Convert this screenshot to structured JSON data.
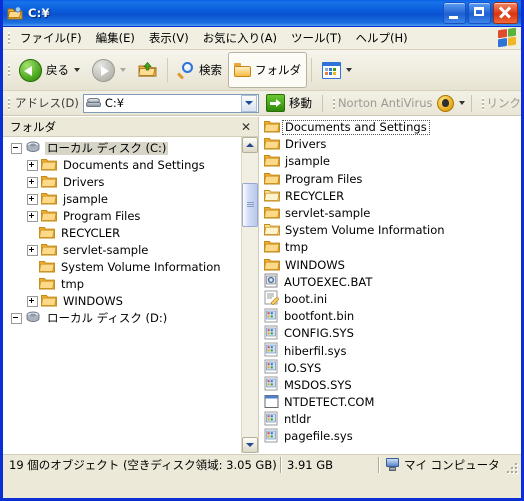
{
  "window": {
    "title": "C:¥",
    "title_icon": "folder-window-icon",
    "buttons": {
      "minimize": "minimize-button",
      "maximize": "maximize-button",
      "close": "close-button"
    }
  },
  "menu": {
    "items": [
      {
        "label": "ファイル(F)",
        "name": "menu-file"
      },
      {
        "label": "編集(E)",
        "name": "menu-edit"
      },
      {
        "label": "表示(V)",
        "name": "menu-view"
      },
      {
        "label": "お気に入り(A)",
        "name": "menu-favorites"
      },
      {
        "label": "ツール(T)",
        "name": "menu-tools"
      },
      {
        "label": "ヘルプ(H)",
        "name": "menu-help"
      }
    ]
  },
  "toolbar": {
    "back_label": "戻る",
    "forward_label": "",
    "up_label": "",
    "search_label": "検索",
    "folders_label": "フォルダ",
    "views_label": ""
  },
  "address": {
    "label": "アドレス(D)",
    "value": "C:¥",
    "go_label": "移動",
    "norton_label": "Norton AntiVirus",
    "links_label": "リンク"
  },
  "tree": {
    "title": "フォルダ",
    "close_glyph": "✕",
    "items": [
      {
        "label": "ローカル ディスク (C:)",
        "icon": "drive-icon",
        "indent": 0,
        "expander": "minus",
        "selected": true
      },
      {
        "label": "Documents and Settings",
        "icon": "folder-icon",
        "indent": 1,
        "expander": "plus",
        "selected": false
      },
      {
        "label": "Drivers",
        "icon": "folder-icon",
        "indent": 1,
        "expander": "plus",
        "selected": false
      },
      {
        "label": "jsample",
        "icon": "folder-icon",
        "indent": 1,
        "expander": "plus",
        "selected": false
      },
      {
        "label": "Program Files",
        "icon": "folder-icon",
        "indent": 1,
        "expander": "plus",
        "selected": false
      },
      {
        "label": "RECYCLER",
        "icon": "folder-icon",
        "indent": 1,
        "expander": "none",
        "selected": false
      },
      {
        "label": "servlet-sample",
        "icon": "folder-icon",
        "indent": 1,
        "expander": "plus",
        "selected": false
      },
      {
        "label": "System Volume Information",
        "icon": "folder-icon",
        "indent": 1,
        "expander": "none",
        "selected": false
      },
      {
        "label": "tmp",
        "icon": "folder-icon",
        "indent": 1,
        "expander": "none",
        "selected": false
      },
      {
        "label": "WINDOWS",
        "icon": "folder-icon",
        "indent": 1,
        "expander": "plus",
        "selected": false
      },
      {
        "label": "ローカル ディスク (D:)",
        "icon": "drive-icon",
        "indent": 0,
        "expander": "minus",
        "selected": false
      }
    ]
  },
  "files": {
    "items": [
      {
        "name": "Documents and Settings",
        "icon": "folder-icon",
        "focused": true
      },
      {
        "name": "Drivers",
        "icon": "folder-icon",
        "focused": false
      },
      {
        "name": "jsample",
        "icon": "folder-icon",
        "focused": false
      },
      {
        "name": "Program Files",
        "icon": "folder-icon",
        "focused": false
      },
      {
        "name": "RECYCLER",
        "icon": "folder-pale-icon",
        "focused": false
      },
      {
        "name": "servlet-sample",
        "icon": "folder-icon",
        "focused": false
      },
      {
        "name": "System Volume Information",
        "icon": "folder-pale-icon",
        "focused": false
      },
      {
        "name": "tmp",
        "icon": "folder-icon",
        "focused": false
      },
      {
        "name": "WINDOWS",
        "icon": "folder-icon",
        "focused": false
      },
      {
        "name": "AUTOEXEC.BAT",
        "icon": "batch-file-icon",
        "focused": false
      },
      {
        "name": "boot.ini",
        "icon": "config-settings-icon",
        "focused": false
      },
      {
        "name": "bootfont.bin",
        "icon": "system-file-icon",
        "focused": false
      },
      {
        "name": "CONFIG.SYS",
        "icon": "system-file-icon",
        "focused": false
      },
      {
        "name": "hiberfil.sys",
        "icon": "system-file-icon",
        "focused": false
      },
      {
        "name": "IO.SYS",
        "icon": "system-file-icon",
        "focused": false
      },
      {
        "name": "MSDOS.SYS",
        "icon": "system-file-icon",
        "focused": false
      },
      {
        "name": "NTDETECT.COM",
        "icon": "ms-dos-application-icon",
        "focused": false
      },
      {
        "name": "ntldr",
        "icon": "system-file-icon",
        "focused": false
      },
      {
        "name": "pagefile.sys",
        "icon": "system-file-icon",
        "focused": false
      }
    ]
  },
  "statusbar": {
    "objects_text": "19 個のオブジェクト (空きディスク領域: 3.05 GB)",
    "size_text": "3.91 GB",
    "zone_text": "マイ コンピュータ"
  },
  "colors": {
    "title_blue": "#0a52cf",
    "window_border": "#0a2fd4",
    "chrome": "#ece9d8",
    "folder_yellow": "#f0a82f",
    "close_red": "#d8340e"
  }
}
